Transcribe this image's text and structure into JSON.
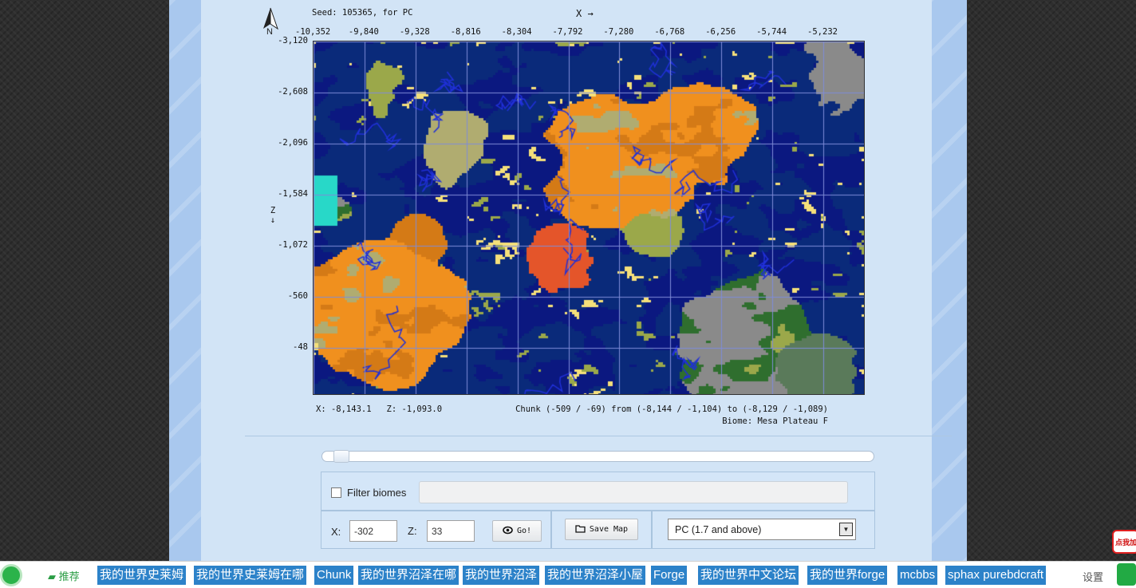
{
  "header": {
    "seed_text": "Seed: 105365, for PC",
    "compass_letter": "N",
    "x_axis_label": "X",
    "x_arrow": "→",
    "z_axis_label": "Z",
    "z_arrow": "↓"
  },
  "map": {
    "x_ticks": [
      "-10,352",
      "-9,840",
      "-9,328",
      "-8,816",
      "-8,304",
      "-7,792",
      "-7,280",
      "-6,768",
      "-6,256",
      "-5,744",
      "-5,232"
    ],
    "z_ticks": [
      "-3,120",
      "-2,608",
      "-2,096",
      "-1,584",
      "-1,072",
      "-560",
      "-48"
    ],
    "cursor_coords": "X: -8,143.1   Z: -1,093.0",
    "chunk_info": "Chunk (-509 / -69) from (-8,144 / -1,104) to (-8,129 / -1,089)",
    "biome_info": "Biome: Mesa Plateau F",
    "colors": {
      "ocean": "#0b1880",
      "deep_ocean": "#0a2a7a",
      "mesa": "#f0901e",
      "mesa_dark": "#d47a16",
      "mesa_red": "#e4552a",
      "plains": "#9ba84a",
      "forest": "#2f6e2e",
      "taiga": "#5a7a5a",
      "mountains": "#8a8a8a",
      "savanna": "#b0ac70",
      "beach": "#f5e07a",
      "ice": "#28d8c8",
      "river": "#2030d8",
      "grid": "#7f8cd8"
    }
  },
  "slider": {
    "value_fraction": 0.02
  },
  "controls": {
    "filter_label": "Filter biomes",
    "x_label": "X:",
    "x_value": "-302",
    "z_label": "Z:",
    "z_value": "33",
    "go_label": "Go!",
    "save_label": "Save Map",
    "version_selected": "PC (1.7 and above)"
  },
  "taskbar": {
    "recommend": "推荐",
    "tags": [
      "我的世界史莱姆",
      "我的世界史莱姆在哪",
      "Chunk",
      "我的世界沼泽在哪",
      "我的世界沼泽",
      "我的世界沼泽小屋",
      "Forge",
      "我的世界中文论坛",
      "我的世界forge",
      "mcbbs",
      "sphax purebdcraft"
    ],
    "settings": "设置",
    "corner_badge": "点我加"
  }
}
